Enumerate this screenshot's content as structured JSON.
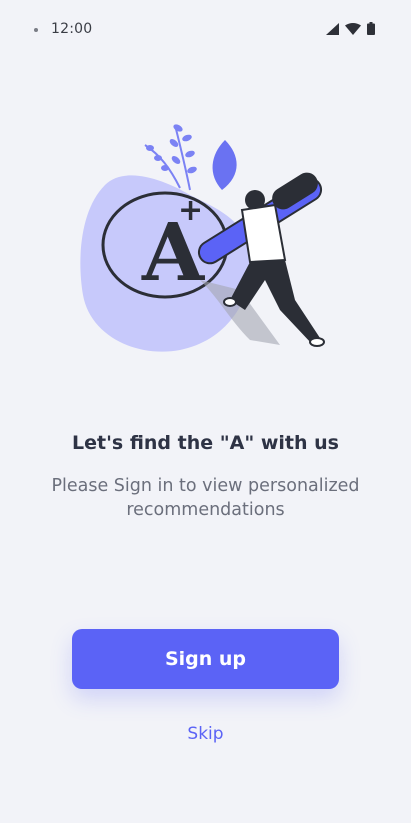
{
  "status_bar": {
    "time": "12:00",
    "icons": [
      "signal-icon",
      "wifi-icon",
      "battery-icon"
    ]
  },
  "illustration": {
    "description_icon": "grade-a-plus-illustration",
    "letter": "A",
    "accent_color": "#5b63f6",
    "blob_color": "#c7c9fb"
  },
  "onboarding": {
    "headline": "Let's find the \"A\" with us",
    "subtext": "Please Sign in to view personalized recommendations"
  },
  "actions": {
    "signup_label": "Sign up",
    "skip_label": "Skip"
  },
  "colors": {
    "background": "#f2f3f8",
    "primary": "#5b63f6",
    "text_dark": "#2e3345",
    "text_muted": "#6b6f7c"
  }
}
